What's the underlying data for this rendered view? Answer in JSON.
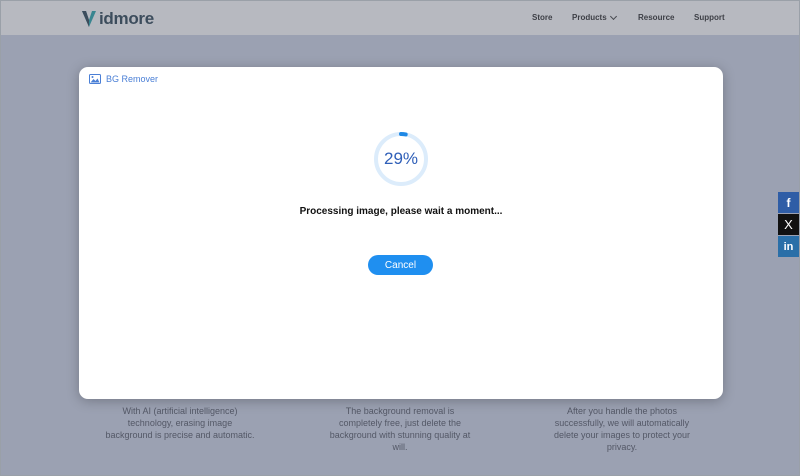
{
  "header": {
    "logo_text": "idmore",
    "nav": {
      "store": "Store",
      "products": "Products",
      "resource": "Resource",
      "support": "Support"
    }
  },
  "features": [
    {
      "text": "With AI (artificial intelligence) technology, erasing image background is precise and automatic."
    },
    {
      "text": "The background removal is completely free, just delete the background with stunning quality at will."
    },
    {
      "text": "After you handle the photos successfully, we will automatically delete your images to protect your privacy."
    }
  ],
  "social": {
    "facebook": "f",
    "x": "X",
    "linkedin": "in"
  },
  "modal": {
    "title": "BG Remover",
    "progress_percent": 29,
    "progress_label": "29%",
    "status": "Processing image, please wait a moment...",
    "cancel_label": "Cancel"
  },
  "colors": {
    "accent": "#1f8ff0",
    "progress_ring": "#1e88e5",
    "progress_track": "#dcecfb",
    "brand_teal": "#1aa0a8"
  }
}
